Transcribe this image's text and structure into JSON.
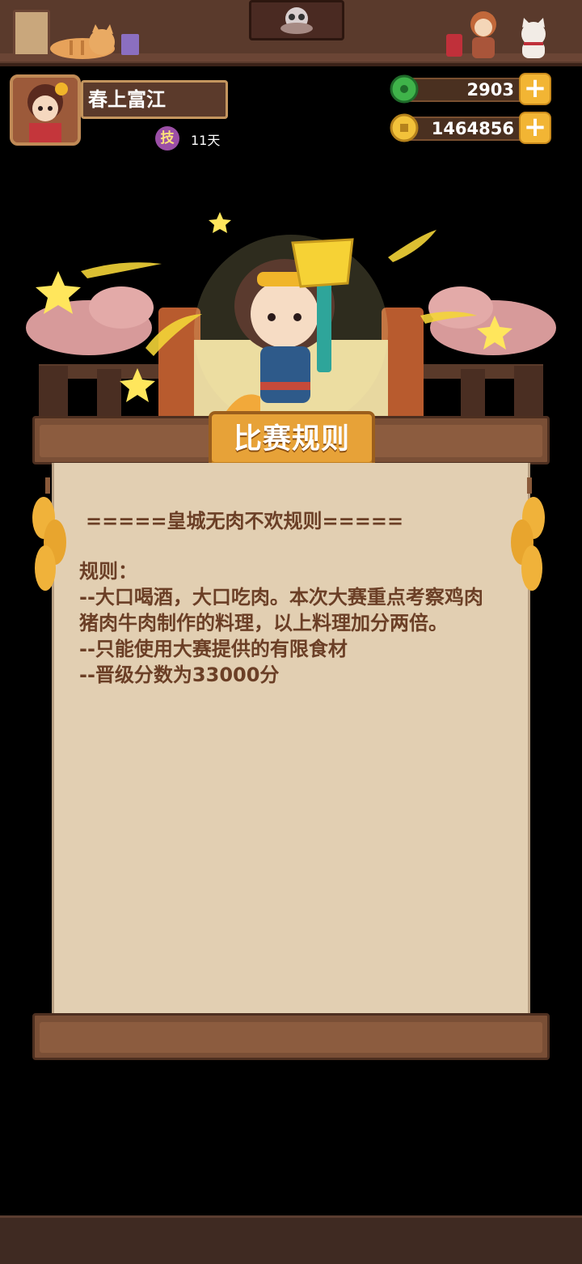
{
  "profile": {
    "name": "春上富江",
    "skill_badge": "技",
    "days": "11天"
  },
  "currencies": {
    "jade": "2903",
    "coins": "1464856",
    "plus_symbol": "+"
  },
  "panel": {
    "title": "比赛规则",
    "header": "=====皇城无肉不欢规则=====",
    "body": "规则：\n--大口喝酒，大口吃肉。本次大赛重点考察鸡肉猪肉牛肉制作的料理，以上料理加分两倍。\n--只能使用大赛提供的有限食材\n--晋级分数为33000分"
  },
  "colors": {
    "panel_paper": "#e2cfb2",
    "text_brown": "#6b3f26",
    "title_gold": "#e7a238",
    "wood": "#7a4f36",
    "accent_plus": "#f2b534"
  },
  "icons": [
    "jade-icon",
    "coin-icon",
    "plus-icon",
    "skill-icon",
    "avatar",
    "chef-character",
    "trophy-icon",
    "star-icon",
    "corn-icon",
    "cat-icon"
  ]
}
